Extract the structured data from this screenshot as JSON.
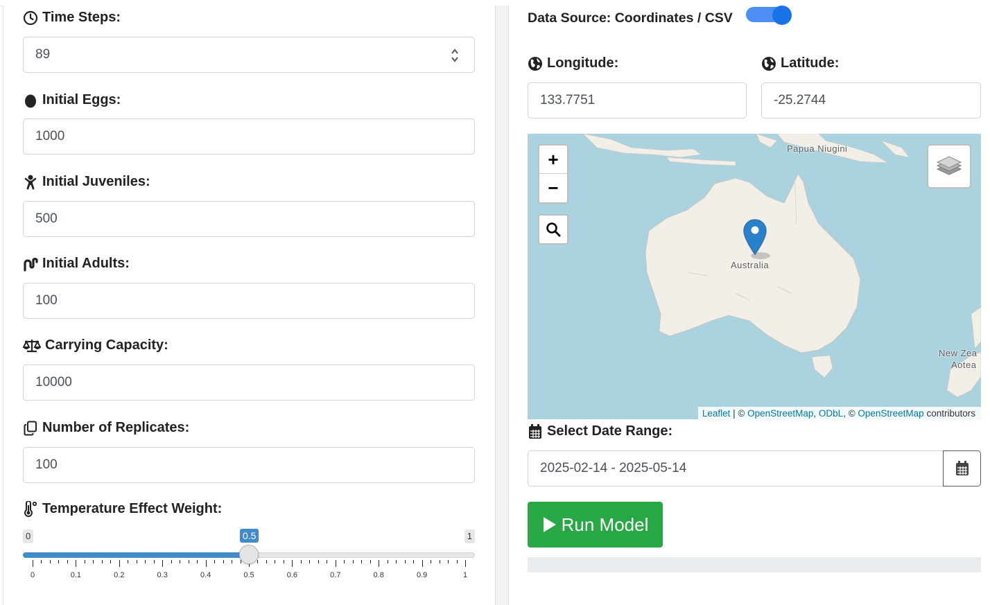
{
  "left": {
    "time_steps": {
      "label": "Time Steps:",
      "value": "89"
    },
    "initial_eggs": {
      "label": "Initial Eggs:",
      "value": "1000"
    },
    "initial_juveniles": {
      "label": "Initial Juveniles:",
      "value": "500"
    },
    "initial_adults": {
      "label": "Initial Adults:",
      "value": "100"
    },
    "carrying_capacity": {
      "label": "Carrying Capacity:",
      "value": "10000"
    },
    "replicates": {
      "label": "Number of Replicates:",
      "value": "100"
    },
    "temp_weight": {
      "label": "Temperature Effect Weight:",
      "min_label": "0",
      "max_label": "1",
      "value_label": "0.5",
      "value": 0.5,
      "min": 0,
      "max": 1,
      "ticks": [
        "0",
        "0.1",
        "0.2",
        "0.3",
        "0.4",
        "0.5",
        "0.6",
        "0.7",
        "0.8",
        "0.9",
        "1"
      ]
    }
  },
  "right": {
    "data_source_label": "Data Source: Coordinates / CSV",
    "data_source_toggle_on": true,
    "longitude": {
      "label": "Longitude:",
      "value": "133.7751"
    },
    "latitude": {
      "label": "Latitude:",
      "value": "-25.2744"
    },
    "map": {
      "zoom_in": "+",
      "zoom_out": "−",
      "labels": {
        "papua": "Papua Niugini",
        "australia": "Australia",
        "nz1": "New Zea",
        "nz2": "Aotea"
      },
      "attribution": {
        "leaflet": "Leaflet",
        "sep1": " | © ",
        "osm": "OpenStreetMap",
        "comma": ", ",
        "odbl": "ODbL",
        "sep2": ", © ",
        "osm2": "OpenStreetMap",
        "contrib": " contributors"
      }
    },
    "date_range": {
      "label": "Select Date Range:",
      "value": "2025-02-14 - 2025-05-14"
    },
    "run_button": "Run Model"
  },
  "colors": {
    "accent": "#428bca",
    "run": "#28a745",
    "toggle": "#1a73e8",
    "water": "#aad3df",
    "land": "#f2efe9",
    "marker": "#2a81cb"
  }
}
